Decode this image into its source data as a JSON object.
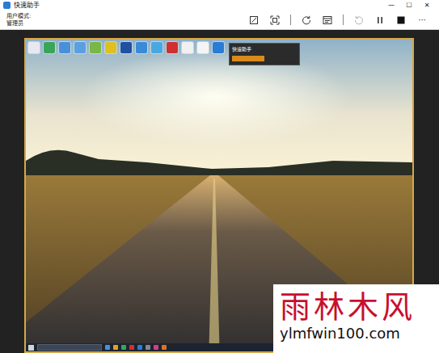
{
  "window": {
    "title": "快速助手",
    "controls": [
      "—",
      "☐",
      "✕"
    ]
  },
  "mode": {
    "label": "用户模式:",
    "value": "管理员"
  },
  "toolbar": [
    {
      "kind": "annotate",
      "disabled": false
    },
    {
      "kind": "fit",
      "disabled": false
    },
    {
      "kind": "separator",
      "disabled": false
    },
    {
      "kind": "reload",
      "disabled": false
    },
    {
      "kind": "taskmgr",
      "disabled": false
    },
    {
      "kind": "separator",
      "disabled": false
    },
    {
      "kind": "restart",
      "disabled": true
    },
    {
      "kind": "pause",
      "disabled": false
    },
    {
      "kind": "stop",
      "disabled": false
    },
    {
      "kind": "more",
      "disabled": false,
      "label": "···"
    }
  ],
  "remote_desktop": {
    "icons": [
      {
        "color": "#e8e8f0"
      },
      {
        "color": "#3aa55a"
      },
      {
        "color": "#4a90d9"
      },
      {
        "color": "#5aa0e0"
      },
      {
        "color": "#7ab648"
      },
      {
        "color": "#e0c020"
      },
      {
        "color": "#2050a0"
      },
      {
        "color": "#3a8ad8"
      },
      {
        "color": "#4aa8e0"
      },
      {
        "color": "#d03030"
      },
      {
        "color": "#f0f0f0"
      },
      {
        "color": "#f4f4f4"
      },
      {
        "color": "#2a7bd4"
      }
    ],
    "popup": {
      "title": "快速助手"
    },
    "taskbar_icons": [
      {
        "color": "#4a90d9"
      },
      {
        "color": "#e0a020"
      },
      {
        "color": "#3aa55a"
      },
      {
        "color": "#d03030"
      },
      {
        "color": "#2a7bd4"
      },
      {
        "color": "#888888"
      },
      {
        "color": "#d04080"
      },
      {
        "color": "#e07020"
      }
    ]
  },
  "watermark": {
    "title": "雨林木风",
    "url": "ylmfwin100.com"
  }
}
